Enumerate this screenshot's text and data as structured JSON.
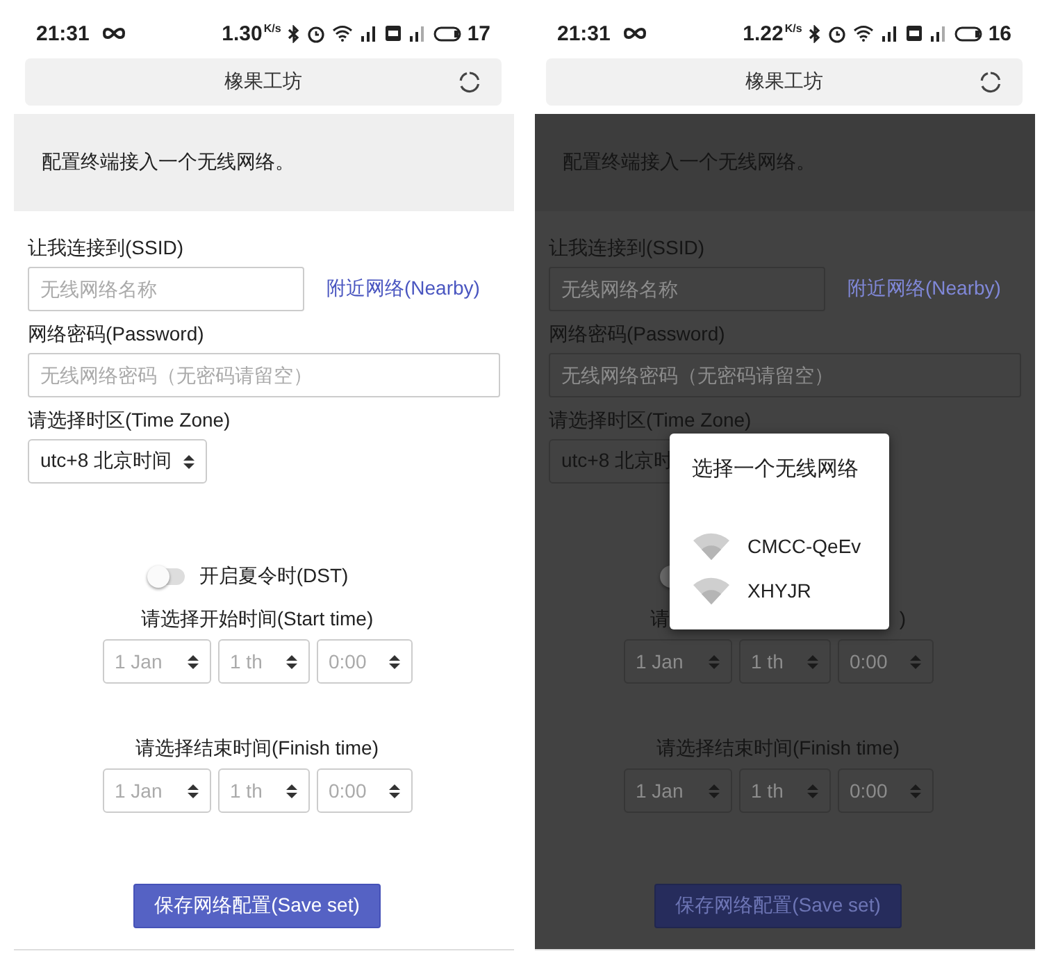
{
  "screens": [
    {
      "status": {
        "time": "21:31",
        "speed": "1.30",
        "speed_unit": "K/s",
        "battery": "17"
      },
      "title": "橡果工坊",
      "banner": "配置终端接入一个无线网络。",
      "ssid": {
        "label": "让我连接到(SSID)",
        "placeholder": "无线网络名称"
      },
      "nearby": "附近网络(Nearby)",
      "password": {
        "label": "网络密码(Password)",
        "placeholder": "无线网络密码（无密码请留空）"
      },
      "timezone": {
        "label": "请选择时区(Time Zone)",
        "value": "utc+8 北京时间"
      },
      "dst": {
        "on": false,
        "label": "开启夏令时(DST)"
      },
      "start": {
        "label_parts": [
          "请选择开始时间(Start time)"
        ],
        "selects": [
          "1 Jan",
          "1 th",
          "0:00"
        ]
      },
      "finish": {
        "label": "请选择结束时间(Finish time)",
        "selects": [
          "1 Jan",
          "1 th",
          "0:00"
        ]
      },
      "save": "保存网络配置(Save set)"
    },
    {
      "status": {
        "time": "21:31",
        "speed": "1.22",
        "speed_unit": "K/s",
        "battery": "16"
      },
      "title": "橡果工坊",
      "banner": "配置终端接入一个无线网络。",
      "ssid": {
        "label": "让我连接到(SSID)",
        "placeholder": "无线网络名称"
      },
      "nearby": "附近网络(Nearby)",
      "password": {
        "label": "网络密码(Password)",
        "placeholder": "无线网络密码（无密码请留空）"
      },
      "timezone": {
        "label": "请选择时区(Time Zone)",
        "value": "utc+8 北京时"
      },
      "dst": {
        "on": false
      },
      "start": {
        "label_parts": [
          "请",
          ")"
        ],
        "selects": [
          "1 Jan",
          "1 th",
          "0:00"
        ]
      },
      "finish": {
        "label": "请选择结束时间(Finish time)",
        "selects": [
          "1 Jan",
          "1 th",
          "0:00"
        ]
      },
      "save": "保存网络配置(Save set)",
      "dialog": {
        "title": "选择一个无线网络",
        "networks": [
          {
            "name": "CMCC-QeEv"
          },
          {
            "name": "XHYJR"
          }
        ]
      }
    }
  ]
}
